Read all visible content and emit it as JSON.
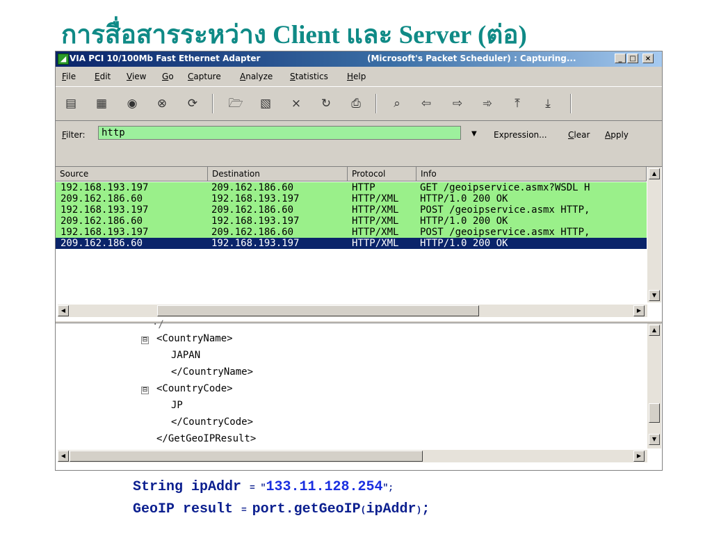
{
  "slide": {
    "title": "การสื่อสารระหว่าง Client และ Server (ต่อ)"
  },
  "window": {
    "title_left": "VIA PCI 10/100Mb Fast Ethernet Adapter",
    "title_right": "(Microsoft's Packet Scheduler) : Capturing...",
    "app_icon": "shark-fin-icon",
    "controls": [
      "_",
      "□",
      "×"
    ]
  },
  "menu": {
    "items": [
      {
        "key": "F",
        "rest": "ile"
      },
      {
        "key": "E",
        "rest": "dit"
      },
      {
        "key": "V",
        "rest": "iew"
      },
      {
        "key": "G",
        "rest": "o"
      },
      {
        "key": "C",
        "rest": "apture"
      },
      {
        "key": "A",
        "rest": "nalyze"
      },
      {
        "key": "S",
        "rest": "tatistics"
      },
      {
        "key": "H",
        "rest": "elp"
      }
    ]
  },
  "toolbar": {
    "icons": [
      "interface-list-icon",
      "capture-options-icon",
      "start-capture-icon",
      "stop-capture-icon",
      "restart-capture-icon",
      "open-file-icon",
      "save-file-icon",
      "close-file-icon",
      "reload-icon",
      "print-icon",
      "find-packet-icon",
      "go-back-icon",
      "go-forward-icon",
      "go-to-packet-icon",
      "go-first-icon",
      "go-last-icon"
    ]
  },
  "filter": {
    "label_key": "F",
    "label_rest": "ilter:",
    "value": "http",
    "expression": "Expression...",
    "clear_key": "C",
    "clear_rest": "lear",
    "apply_key": "A",
    "apply_rest": "pply"
  },
  "packets": {
    "columns": [
      "Source",
      "Destination",
      "Protocol",
      "Info"
    ],
    "rows": [
      {
        "source": "192.168.193.197",
        "destination": "209.162.186.60",
        "protocol": "HTTP",
        "info": "GET /geoipservice.asmx?WSDL H",
        "selected": false
      },
      {
        "source": "209.162.186.60",
        "destination": "192.168.193.197",
        "protocol": "HTTP/XML",
        "info": "HTTP/1.0 200 OK",
        "selected": false
      },
      {
        "source": "192.168.193.197",
        "destination": "209.162.186.60",
        "protocol": "HTTP/XML",
        "info": "POST /geoipservice.asmx HTTP,",
        "selected": false
      },
      {
        "source": "209.162.186.60",
        "destination": "192.168.193.197",
        "protocol": "HTTP/XML",
        "info": "HTTP/1.0 200 OK",
        "selected": false
      },
      {
        "source": "192.168.193.197",
        "destination": "209.162.186.60",
        "protocol": "HTTP/XML",
        "info": "POST /geoipservice.asmx HTTP,",
        "selected": false
      },
      {
        "source": "209.162.186.60",
        "destination": "192.168.193.197",
        "protocol": "HTTP/XML",
        "info": "HTTP/1.0 200 OK",
        "selected": true
      }
    ]
  },
  "details": {
    "lines": [
      "<CountryName>",
      "JAPAN",
      "</CountryName>",
      "<CountryCode>",
      "JP",
      "</CountryCode>",
      "</GetGeoIPResult>"
    ],
    "expander": "⊟"
  },
  "code": {
    "line1_a": "String ipAddr ",
    "line1_eq": "= \"",
    "line1_str": "133.11.128.254",
    "line1_end": "\";",
    "line2_a": "GeoIP result ",
    "line2_eq": "= ",
    "line2_b": "port.getGeoIP",
    "line2_p1": "(",
    "line2_c": "ipAddr",
    "line2_p2": ")",
    "line2_end": ";"
  }
}
